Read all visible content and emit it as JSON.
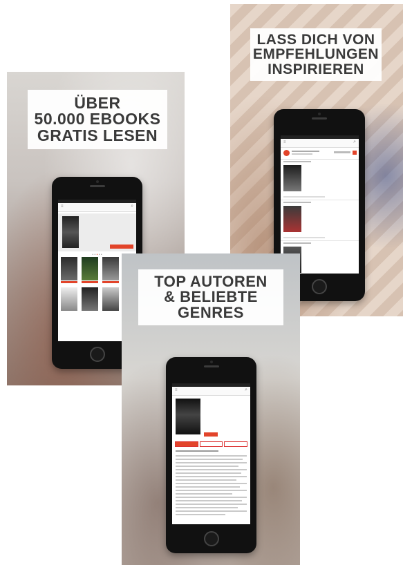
{
  "cards": {
    "left": {
      "lines": [
        "ÜBER",
        "50.000 EBOOKS",
        "GRATIS LESEN"
      ]
    },
    "right": {
      "lines": [
        "LASS DICH VON",
        "EMPFEHLUNGEN",
        "INSPIRIEREN"
      ]
    },
    "center": {
      "lines": [
        "TOP AUTOREN",
        "& BELIEBTE",
        "GENRES"
      ]
    }
  },
  "colors": {
    "accent": "#e2442a",
    "headline_text": "#3a3a3a",
    "phone_body": "#111111"
  },
  "icons": [
    "menu-icon",
    "search-icon",
    "home-button-icon"
  ]
}
